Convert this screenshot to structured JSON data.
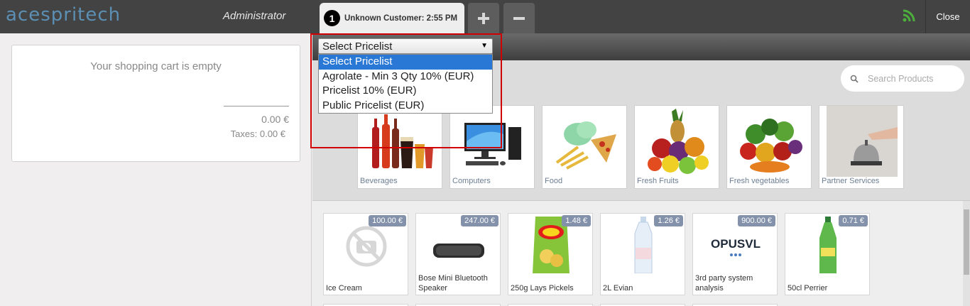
{
  "header": {
    "logo_text": "acespritech",
    "user": "Administrator",
    "order_tab": {
      "number": "1",
      "label": "Unknown Customer: 2:55 PM"
    },
    "close_label": "Close"
  },
  "cart": {
    "empty_message": "Your shopping cart is empty",
    "total": "0.00 €",
    "taxes": "Taxes: 0.00 €"
  },
  "pricelist": {
    "selected": "Select Pricelist",
    "options": [
      "Select Pricelist",
      "Agrolate - Min 3 Qty 10% (EUR)",
      "Pricelist 10% (EUR)",
      "Public Pricelist (EUR)"
    ]
  },
  "search": {
    "placeholder": "Search Products"
  },
  "categories": [
    {
      "name": "Beverages"
    },
    {
      "name": "Computers"
    },
    {
      "name": "Food"
    },
    {
      "name": "Fresh Fruits"
    },
    {
      "name": "Fresh vegetables"
    },
    {
      "name": "Partner Services"
    }
  ],
  "products": [
    {
      "name": "Ice Cream",
      "price": "100.00 €"
    },
    {
      "name": "Bose Mini Bluetooth Speaker",
      "price": "247.00 €"
    },
    {
      "name": "250g Lays Pickels",
      "price": "1.48 €"
    },
    {
      "name": "2L Evian",
      "price": "1.26 €"
    },
    {
      "name": "3rd party system analysis",
      "price": "900.00 €",
      "logo": "OPUSVL"
    },
    {
      "name": "50cl Perrier",
      "price": "0.71 €"
    }
  ],
  "colors": {
    "topbar": "#434343",
    "price_badge": "#8391aa",
    "highlight_box": "#d10000",
    "selected_option": "#2a78d6"
  }
}
